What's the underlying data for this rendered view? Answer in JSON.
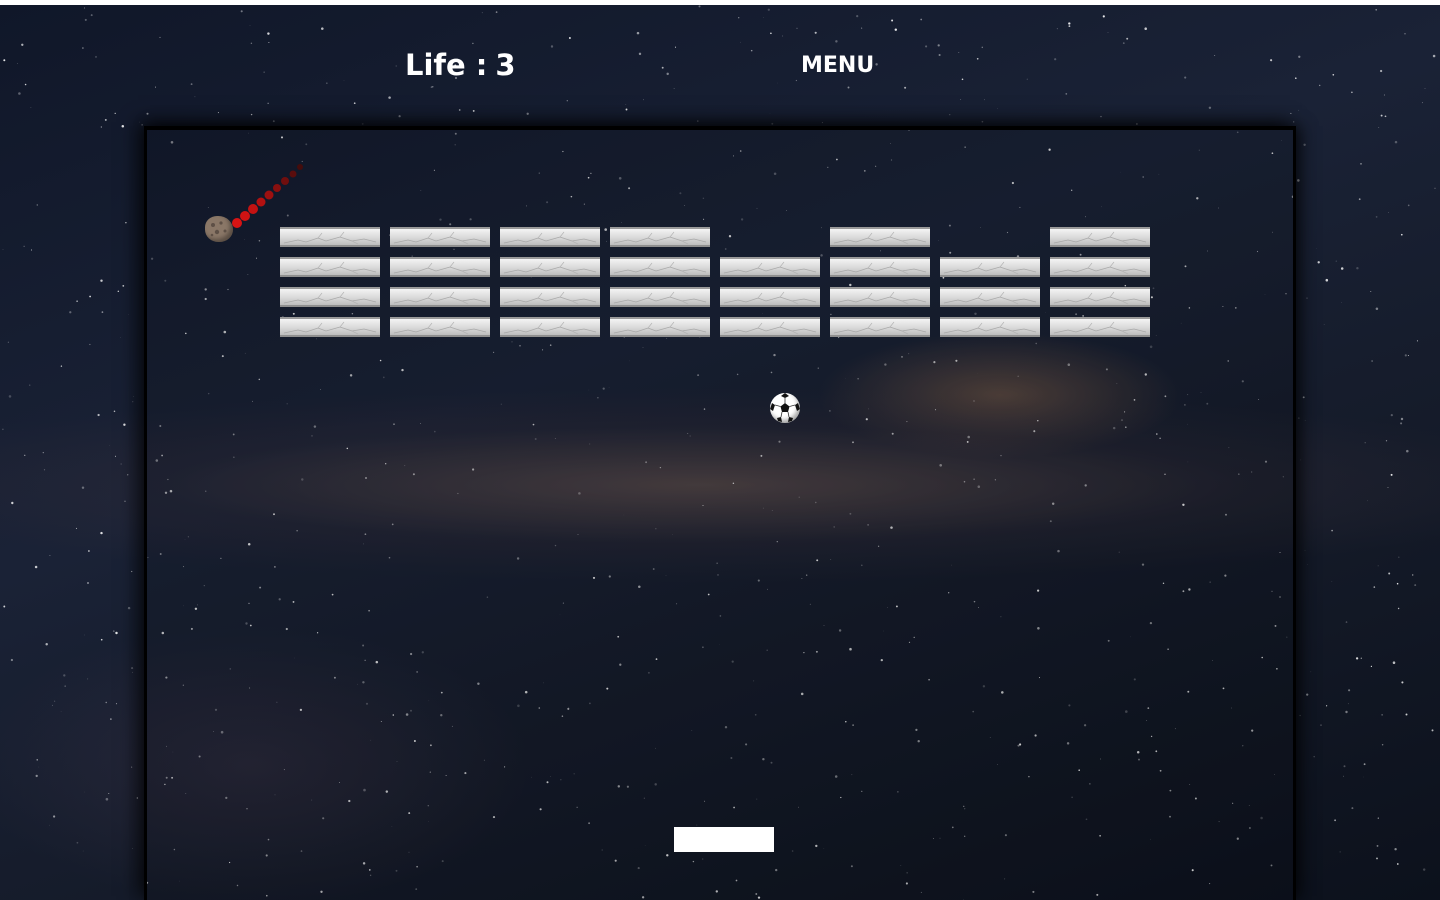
{
  "hud": {
    "life_label": "Life :",
    "life_value": "3",
    "menu_label": "MENU"
  },
  "bricks": {
    "columns": 8,
    "rows": 4,
    "present": [
      [
        1,
        1,
        1,
        1,
        0,
        1,
        0,
        1
      ],
      [
        1,
        1,
        1,
        1,
        1,
        1,
        1,
        1
      ],
      [
        1,
        1,
        1,
        1,
        1,
        1,
        1,
        1
      ],
      [
        1,
        1,
        1,
        1,
        1,
        1,
        1,
        1
      ]
    ]
  },
  "entities": {
    "ball_icon": "soccer-ball-icon",
    "meteor_icon": "meteor-icon",
    "paddle": "paddle"
  },
  "colors": {
    "hud_text": "#ffffff",
    "paddle": "#ffffff",
    "trail": "#cc1111"
  }
}
